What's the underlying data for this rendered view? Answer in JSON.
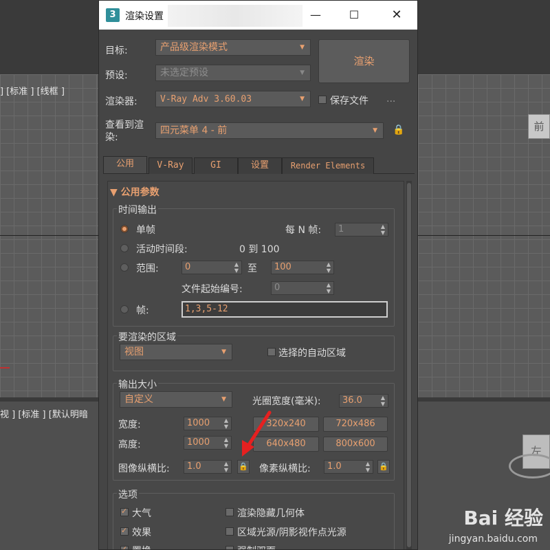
{
  "background": {
    "viewport_top_left_label": "] [标准 ] [线框 ]",
    "viewport_bottom_left_label": "视 ] [标准 ] [默认明暗",
    "top_right_cube_label": "前",
    "bottom_right_cube_label": "左"
  },
  "titlebar": {
    "app_icon": "3",
    "title": "渲染设置",
    "minimize": "—",
    "maximize": "☐",
    "close": "✕"
  },
  "header": {
    "target_label": "目标:",
    "target_value": "产品级渲染模式",
    "preset_label": "预设:",
    "preset_value": "未选定预设",
    "renderer_label": "渲染器:",
    "renderer_value": "V-Ray Adv 3.60.03",
    "save_file_label": "保存文件",
    "more_label": "...",
    "view_label": "查看到渲染:",
    "view_value": "四元菜单 4 - 前",
    "render_button": "渲染"
  },
  "tabs": [
    {
      "label": "公用",
      "active": true
    },
    {
      "label": "V-Ray",
      "active": false
    },
    {
      "label": "GI",
      "active": false
    },
    {
      "label": "设置",
      "active": false
    },
    {
      "label": "Render Elements",
      "active": false
    }
  ],
  "common": {
    "rollout_title": "▼ 公用参数",
    "time_output": {
      "title": "时间输出",
      "single_label": "单帧",
      "every_n_label": "每 N 帧:",
      "every_n_value": "1",
      "active_segment_label": "活动时间段:",
      "active_segment_value": "0 到 100",
      "range_label": "范围:",
      "range_from": "0",
      "range_to_label": "至",
      "range_to": "100",
      "file_start_label": "文件起始编号:",
      "file_start_value": "0",
      "frames_label": "帧:",
      "frames_value": "1,3,5-12"
    },
    "area": {
      "title": "要渲染的区域",
      "value": "视图",
      "auto_region_label": "选择的自动区域"
    },
    "output_size": {
      "title": "输出大小",
      "preset_value": "自定义",
      "aperture_label": "光圈宽度(毫米):",
      "aperture_value": "36.0",
      "width_label": "宽度:",
      "width_value": "1000",
      "height_label": "高度:",
      "height_value": "1000",
      "presets": [
        "320x240",
        "720x486",
        "640x480",
        "800x600"
      ],
      "image_aspect_label": "图像纵横比:",
      "image_aspect_value": "1.0",
      "pixel_aspect_label": "像素纵横比:",
      "pixel_aspect_value": "1.0"
    },
    "options": {
      "title": "选项",
      "atmosphere": "大气",
      "effects": "效果",
      "displacement": "置换",
      "render_hidden": "渲染隐藏几何体",
      "area_lights": "区域光源/阴影视作点光源",
      "force_two_sided": "强制双面"
    }
  },
  "watermark": {
    "logo": "Bai 经验",
    "url": "jingyan.baidu.com"
  }
}
